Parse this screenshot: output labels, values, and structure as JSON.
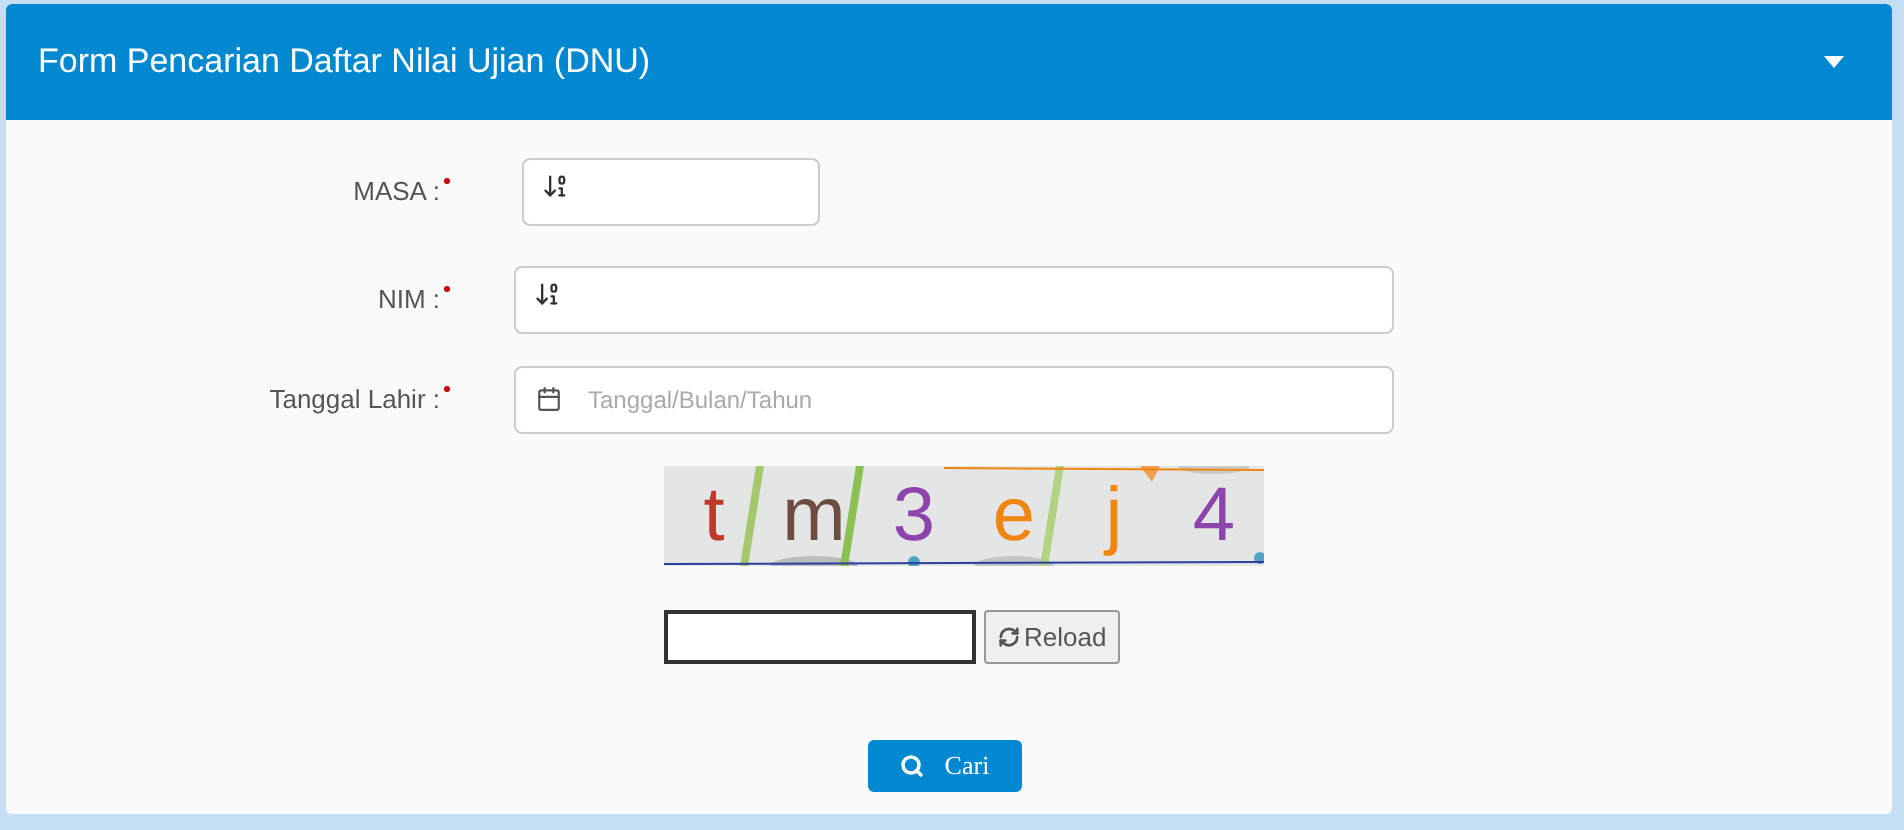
{
  "panel": {
    "title": "Form Pencarian Daftar Nilai Ujian (DNU)",
    "expanded": true
  },
  "fields": [
    {
      "label": "MASA :",
      "required": true,
      "kind": "number"
    },
    {
      "label": "NIM :",
      "required": true,
      "kind": "number"
    },
    {
      "label": "Tanggal Lahir :",
      "required": true,
      "kind": "date",
      "placeholder": "Tanggal/Bulan/Tahun"
    }
  ],
  "captcha": {
    "chars": [
      {
        "text": "t",
        "color": "#c0392b"
      },
      {
        "text": "m",
        "color": "#6d4c41"
      },
      {
        "text": "3",
        "color": "#8e44ad"
      },
      {
        "text": "e",
        "color": "#f0850f"
      },
      {
        "text": "j",
        "color": "#f0850f"
      },
      {
        "text": "4",
        "color": "#8e44ad"
      }
    ]
  },
  "reload_button": "Reload",
  "search_button": "Cari"
}
